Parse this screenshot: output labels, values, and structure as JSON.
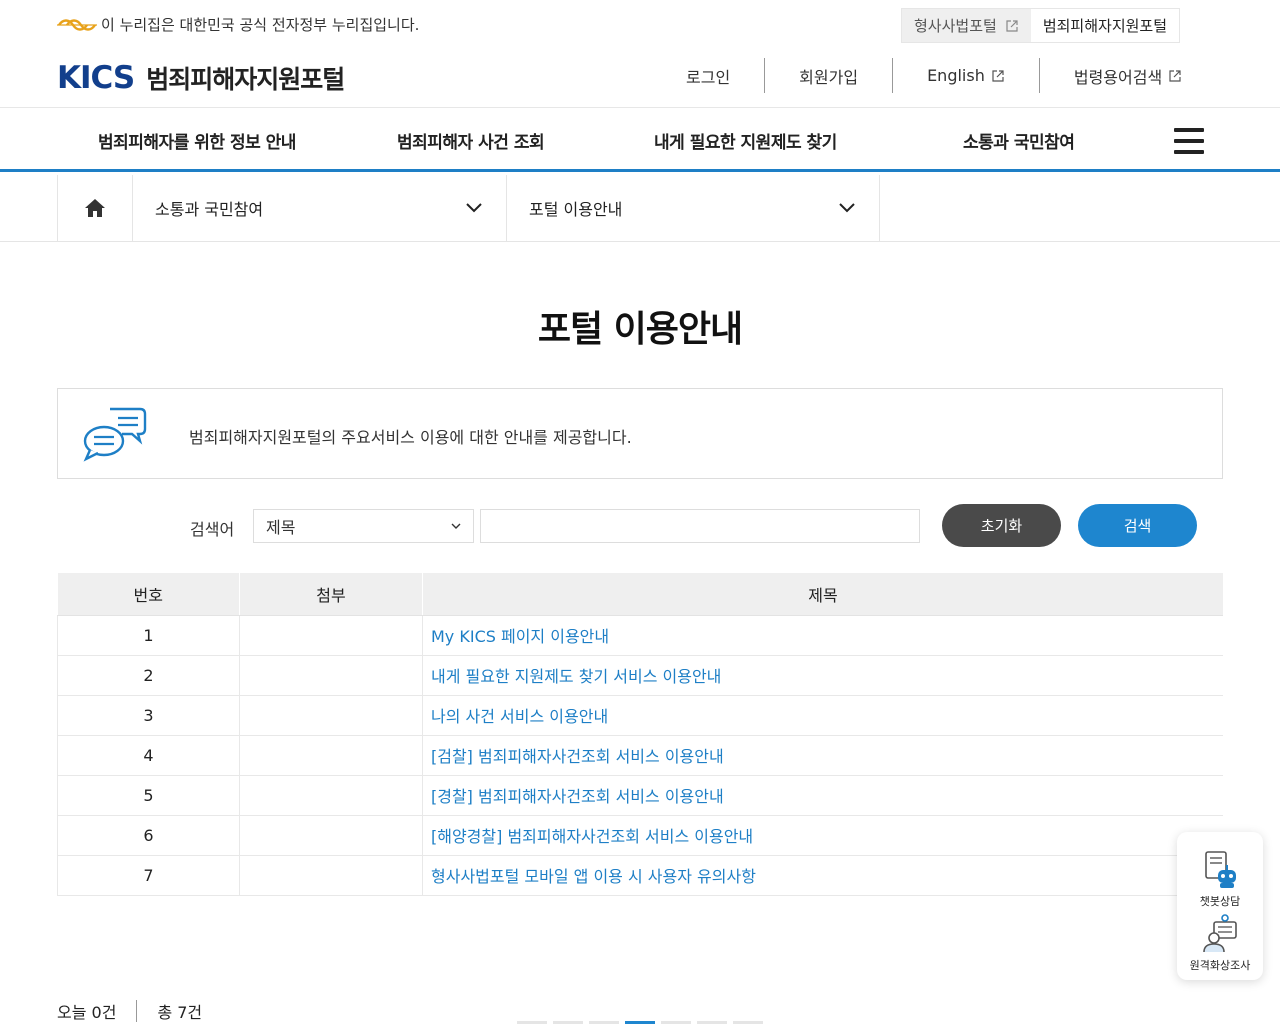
{
  "gov_banner": {
    "text": "이 누리집은 대한민국 공식 전자정부 누리집입니다.",
    "portals": [
      {
        "label": "형사사법포털",
        "external": true
      },
      {
        "label": "범죄피해자지원포털",
        "external": false
      }
    ]
  },
  "header": {
    "logo_text": "KICS",
    "site_name": "범죄피해자지원포털",
    "util_nav": [
      {
        "label": "로그인"
      },
      {
        "label": "회원가입"
      },
      {
        "label": "English",
        "external": true
      },
      {
        "label": "법령용어검색",
        "external": true
      }
    ]
  },
  "gnb": {
    "items": [
      "범죄피해자를 위한 정보 안내",
      "범죄피해자 사건 조회",
      "내게 필요한 지원제도 찾기",
      "소통과 국민참여"
    ],
    "menu_icon": "hamburger-icon"
  },
  "breadcrumb": {
    "home_icon": "home-icon",
    "level1": "소통과 국민참여",
    "level2": "포털 이용안내"
  },
  "page": {
    "title": "포털 이용안내",
    "info": "범죄피해자지원포털의 주요서비스 이용에 대한 안내를 제공합니다."
  },
  "search": {
    "label": "검색어",
    "select_value": "제목",
    "input_value": "",
    "reset_label": "초기화",
    "search_label": "검색"
  },
  "table": {
    "headers": [
      "번호",
      "첨부",
      "제목"
    ],
    "rows": [
      {
        "no": "1",
        "attach": "",
        "title": "My KICS 페이지 이용안내"
      },
      {
        "no": "2",
        "attach": "",
        "title": "내게 필요한 지원제도 찾기 서비스 이용안내"
      },
      {
        "no": "3",
        "attach": "",
        "title": "나의 사건 서비스 이용안내"
      },
      {
        "no": "4",
        "attach": "",
        "title": "[검찰] 범죄피해자사건조회 서비스 이용안내"
      },
      {
        "no": "5",
        "attach": "",
        "title": "[경찰] 범죄피해자사건조회 서비스 이용안내"
      },
      {
        "no": "6",
        "attach": "",
        "title": "[해양경찰] 범죄피해자사건조회 서비스 이용안내"
      },
      {
        "no": "7",
        "attach": "",
        "title": "형사사법포털 모바일 앱 이용 시 사용자 유의사항"
      }
    ]
  },
  "counts": {
    "today": "오늘 0건",
    "total": "총 7건"
  },
  "float_widget": {
    "chatbot": "챗봇상담",
    "remote": "원격화상조사"
  },
  "colors": {
    "brand": "#1e7fc6",
    "logo": "#123f8c"
  }
}
